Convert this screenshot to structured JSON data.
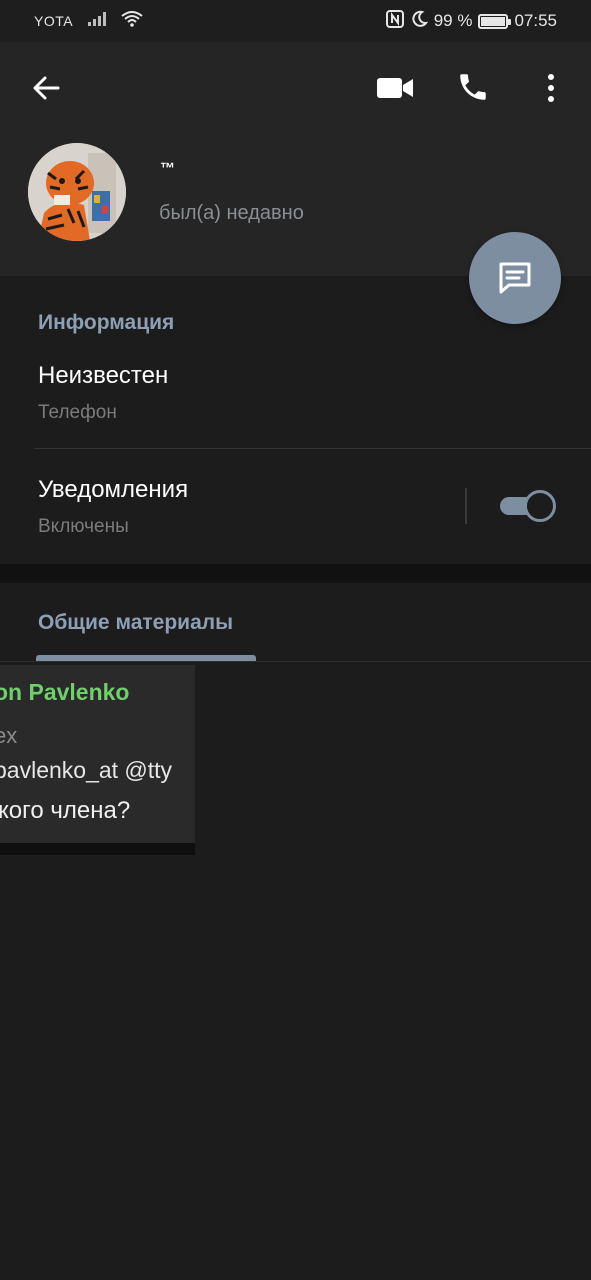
{
  "status_bar": {
    "carrier": "YOTA",
    "battery_percent": "99 %",
    "battery_level": 0.99,
    "time": "07:55",
    "icons": [
      "signal-icon",
      "wifi-icon",
      "nfc-icon",
      "moon-icon",
      "battery-icon"
    ]
  },
  "header": {
    "back_icon": "arrow-left-icon",
    "video_icon": "video-camera-icon",
    "call_icon": "phone-icon",
    "more_icon": "more-vertical-icon",
    "name": "™",
    "last_seen": "был(а) недавно"
  },
  "fab": {
    "icon": "message-icon"
  },
  "info": {
    "title": "Информация",
    "phone_value": "Неизвестен",
    "phone_label": "Телефон",
    "notifications_label": "Уведомления",
    "notifications_status": "Включены",
    "notifications_enabled": true
  },
  "shared": {
    "title": "Общие материалы",
    "media_preview": {
      "name": "on Pavlenko",
      "sub": "ex",
      "mention": "pavlenko_at @tty",
      "text": "кого члена?"
    }
  },
  "colors": {
    "accent": "#7d8ea1",
    "section_title": "#8d9fb4",
    "background": "#1c1c1c",
    "header_bg": "#252525"
  }
}
